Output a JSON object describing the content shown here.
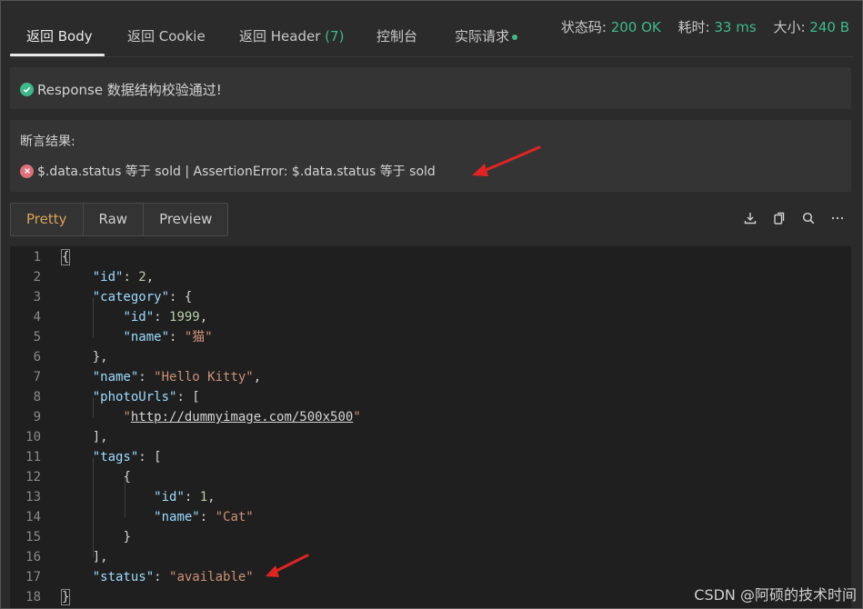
{
  "tabs": [
    {
      "label": "返回 Body"
    },
    {
      "label": "返回 Cookie"
    },
    {
      "label": "返回 Header",
      "count": "(7)"
    },
    {
      "label": "控制台"
    },
    {
      "label": "实际请求"
    }
  ],
  "status": {
    "code_label": "状态码:",
    "code_value": "200 OK",
    "time_label": "耗时:",
    "time_value": "33 ms",
    "size_label": "大小:",
    "size_value": "240 B"
  },
  "validation": {
    "text": "Response 数据结构校验通过!"
  },
  "assertion": {
    "title": "断言结果:",
    "error": "$.data.status 等于 sold | AssertionError: $.data.status 等于 sold"
  },
  "views": [
    "Pretty",
    "Raw",
    "Preview"
  ],
  "active_view": "Pretty",
  "icons": [
    "download-icon",
    "copy-icon",
    "search-icon",
    "more-icon"
  ],
  "colors": {
    "accent_green": "#3fb98a",
    "error_red": "#e0707a",
    "active_orange": "#d9a35a",
    "arrow_red": "#e02424"
  },
  "code": {
    "line_numbers": [
      "1",
      "2",
      "3",
      "4",
      "5",
      "6",
      "7",
      "8",
      "9",
      "10",
      "11",
      "12",
      "13",
      "14",
      "15",
      "16",
      "17",
      "18"
    ],
    "l1": "{",
    "l2k": "\"id\"",
    "l2v": "2",
    "l3k": "\"category\"",
    "l4k": "\"id\"",
    "l4v": "1999",
    "l5k": "\"name\"",
    "l5v": "\"猫\"",
    "l6": "},",
    "l7k": "\"name\"",
    "l7v": "\"Hello Kitty\"",
    "l8k": "\"photoUrls\"",
    "l9v": "http://dummyimage.com/500x500",
    "l10": "],",
    "l11k": "\"tags\"",
    "l12": "{",
    "l13k": "\"id\"",
    "l13v": "1",
    "l14k": "\"name\"",
    "l14v": "\"Cat\"",
    "l15": "}",
    "l16": "],",
    "l17k": "\"status\"",
    "l17v": "\"available\"",
    "l18": "}"
  },
  "watermark": "CSDN @阿硕的技术时间"
}
